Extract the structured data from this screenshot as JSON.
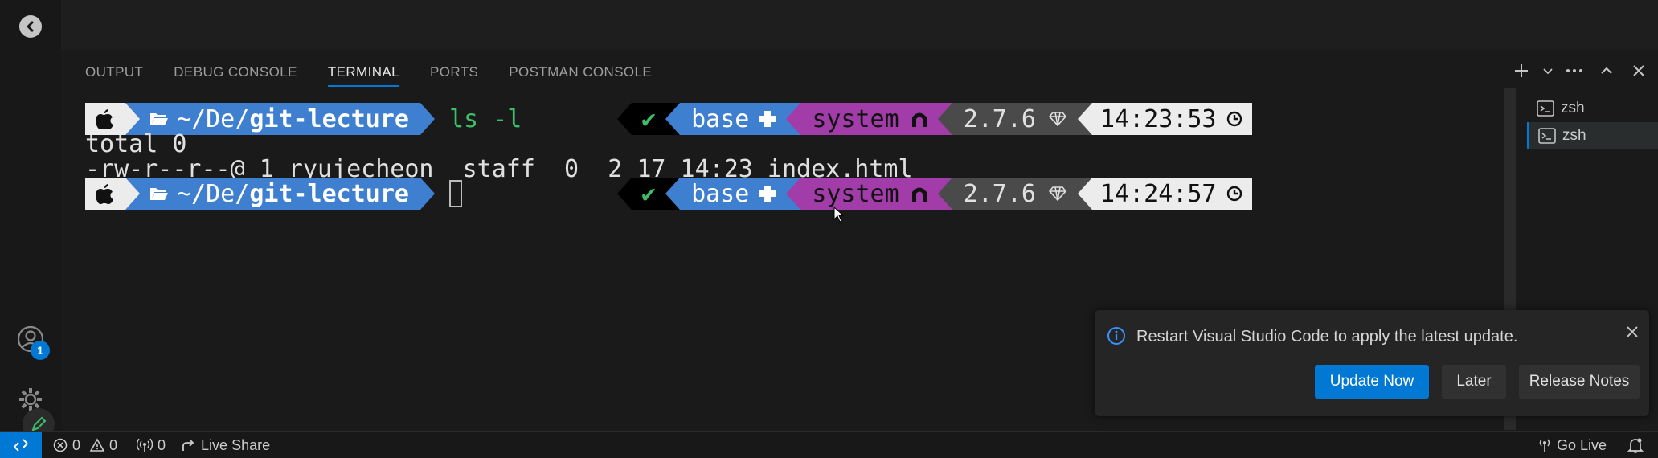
{
  "panel": {
    "tabs": [
      {
        "label": "OUTPUT"
      },
      {
        "label": "DEBUG CONSOLE"
      },
      {
        "label": "TERMINAL"
      },
      {
        "label": "PORTS"
      },
      {
        "label": "POSTMAN CONSOLE"
      }
    ],
    "active_tab": "TERMINAL"
  },
  "terminal": {
    "lines": [
      {
        "path": "~/De/",
        "dir": "git-lecture",
        "command": "ls -l",
        "status": "✔",
        "env": "base",
        "ruby": "system",
        "version": "2.7.6",
        "time": "14:23:53"
      },
      {
        "path": "~/De/",
        "dir": "git-lecture",
        "command": "",
        "status": "✔",
        "env": "base",
        "ruby": "system",
        "version": "2.7.6",
        "time": "14:24:57"
      }
    ],
    "output": [
      "total 0",
      "-rw-r--r--@ 1 ryujecheon  staff  0  2 17 14:23 index.html"
    ],
    "sessions": [
      {
        "label": "zsh"
      },
      {
        "label": "zsh"
      }
    ]
  },
  "notification": {
    "message": "Restart Visual Studio Code to apply the latest update.",
    "buttons": {
      "update": "Update Now",
      "later": "Later",
      "notes": "Release Notes"
    }
  },
  "activity": {
    "accounts_badge": "1"
  },
  "status_bar": {
    "errors": "0",
    "warnings": "0",
    "ports": "0",
    "live_share": "Live Share",
    "go_live": "Go Live"
  },
  "colors": {
    "accent": "#0078d4",
    "prompt_blue": "#3f7fd0",
    "prompt_white": "#ececec",
    "prompt_magenta": "#a13ca8",
    "prompt_grey": "#4a4a4a",
    "command_green": "#3dbf6a"
  }
}
